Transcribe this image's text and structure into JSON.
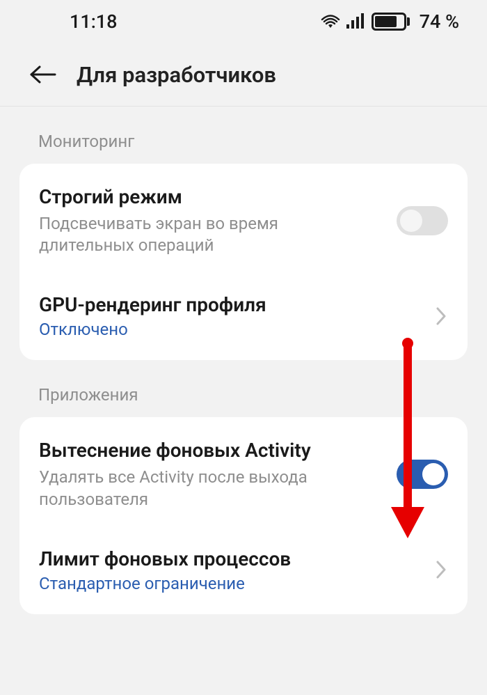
{
  "status": {
    "time": "11:18",
    "battery_pct": "74 %"
  },
  "header": {
    "title": "Для разработчиков"
  },
  "sections": {
    "monitoring": {
      "label": "Мониторинг",
      "strict_mode": {
        "title": "Строгий режим",
        "subtitle": "Подсвечивать экран во время длительных операций",
        "enabled": false
      },
      "gpu_profile": {
        "title": "GPU-рендеринг профиля",
        "value": "Отключено"
      }
    },
    "apps": {
      "label": "Приложения",
      "dont_keep": {
        "title": "Вытеснение фоновых Activity",
        "subtitle": "Удалять все Activity после выхода пользователя",
        "enabled": true
      },
      "bg_limit": {
        "title": "Лимит фоновых процессов",
        "value": "Стандартное ограничение"
      }
    }
  }
}
